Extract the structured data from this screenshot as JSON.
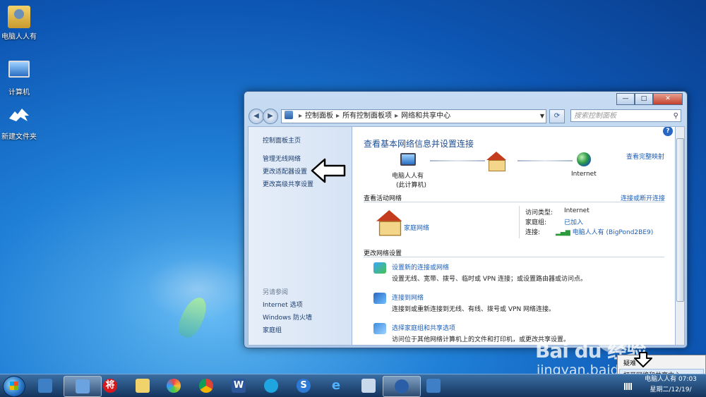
{
  "desktop": {
    "icons": [
      {
        "label": "电脑人人有",
        "icon": "user-folder-icon"
      },
      {
        "label": "计算机",
        "icon": "computer-icon"
      },
      {
        "label": "新建文件夹",
        "icon": "folder-icon"
      }
    ]
  },
  "window": {
    "buttons": {
      "minimize": "—",
      "maximize": "□",
      "close": "✕"
    },
    "address": {
      "segments": [
        "控制面板",
        "所有控制面板项",
        "网络和共享中心"
      ],
      "separator": "▸"
    },
    "search_placeholder": "搜索控制面板",
    "left_pane": {
      "home": "控制面板主页",
      "links": [
        "管理无线网络",
        "更改适配器设置",
        "更改高级共享设置"
      ],
      "see_also_header": "另请参阅",
      "see_also": [
        "Internet 选项",
        "Windows 防火墙",
        "家庭组"
      ]
    },
    "main": {
      "title": "查看基本网络信息并设置连接",
      "view_full_map": "查看完整映射",
      "map": {
        "pc_name": "电脑人人有",
        "pc_sub": "(此计算机)",
        "internet": "Internet"
      },
      "active_networks": {
        "header": "查看活动网络",
        "connect_link": "连接或断开连接",
        "network_name": "家庭网络",
        "access_type_label": "访问类型:",
        "access_type_value": "Internet",
        "homegroup_label": "家庭组:",
        "homegroup_value": "已加入",
        "connection_label": "连接:",
        "connection_value": "电脑人人有 (BigPond2BE9)"
      },
      "change_settings": {
        "header": "更改网络设置",
        "items": [
          {
            "title": "设置新的连接或网络",
            "desc": "设置无线、宽带、拨号、临时或 VPN 连接；或设置路由器或访问点。"
          },
          {
            "title": "连接到网络",
            "desc": "连接到或重新连接到无线、有线、拨号或 VPN 网络连接。"
          },
          {
            "title": "选择家庭组和共享选项",
            "desc": "访问位于其他网络计算机上的文件和打印机，或更改共享设置。"
          }
        ]
      }
    }
  },
  "taskbar": {
    "clock_time": "电脑人人有 07:03",
    "clock_date": "星期二/12/19/",
    "pinned": [
      "computer-icon",
      "control-panel-icon",
      "chess-icon",
      "folder-icon",
      "paint-icon",
      "chrome-icon",
      "word-icon",
      "edge-icon",
      "sogou-icon",
      "ie-icon",
      "file-icon",
      "media-icon",
      "monitor-icon"
    ]
  },
  "popup": {
    "item1": "疑难",
    "item2": "打开网络和共享中心"
  },
  "watermark": {
    "brand": "Bai du 经验",
    "url": "jingyan.baidu.com"
  }
}
